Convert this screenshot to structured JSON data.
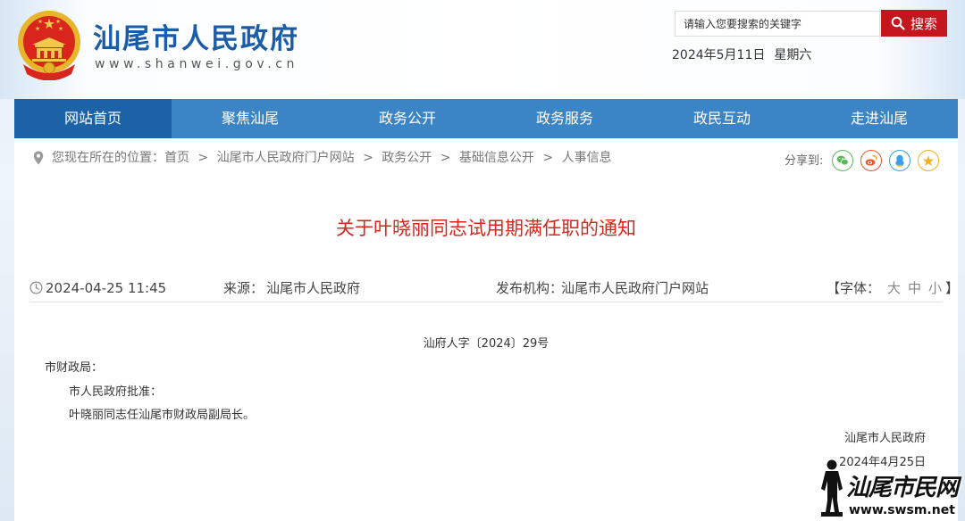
{
  "header": {
    "site_title": "汕尾市人民政府",
    "site_url": "www.shanwei.gov.cn",
    "emblem_icon": "national-emblem-icon",
    "search": {
      "placeholder": "请输入您要搜索的关键字",
      "button_label": "搜索",
      "icon": "search-icon"
    },
    "date": "2024年5月11日",
    "weekday": "星期六"
  },
  "nav": {
    "items": [
      "网站首页",
      "聚焦汕尾",
      "政务公开",
      "政务服务",
      "政民互动",
      "走进汕尾"
    ],
    "active_index": 0
  },
  "breadcrumb": {
    "icon": "location-pin-icon",
    "prefix": "您现在所在的位置：",
    "separator": ">",
    "items": [
      "首页",
      "汕尾市人民政府门户网站",
      "政务公开",
      "基础信息公开",
      "人事信息"
    ]
  },
  "share": {
    "label": "分享到:",
    "icons": [
      "wechat-icon",
      "weibo-icon",
      "qq-icon",
      "qzone-icon"
    ]
  },
  "article": {
    "title": "关于叶晓丽同志试用期满任职的通知",
    "time_icon": "clock-icon",
    "publish_time": "2024-04-25 11:45",
    "source_label": "来源：",
    "source": "汕尾市人民政府",
    "publisher_label": "发布机构：",
    "publisher": "汕尾市人民政府门户网站",
    "font_size_open": "【字体：",
    "font_sizes": [
      "大",
      "中",
      "小"
    ],
    "font_size_close": "】",
    "doc_number": "汕府人字〔2024〕29号",
    "addressee": "市财政局：",
    "paragraphs": [
      "市人民政府批准：",
      "叶晓丽同志任汕尾市财政局副局长。"
    ],
    "signature": "汕尾市人民政府",
    "signature_date": "2024年4月25日"
  },
  "watermark": {
    "name": "汕尾市民网",
    "url": "www.swsm.net"
  },
  "colors": {
    "nav_bg": "#3b84c5",
    "nav_active": "#1b62a6",
    "brand": "#1a5ca8",
    "title_red": "#d9261c",
    "search_red": "#c4161c"
  }
}
